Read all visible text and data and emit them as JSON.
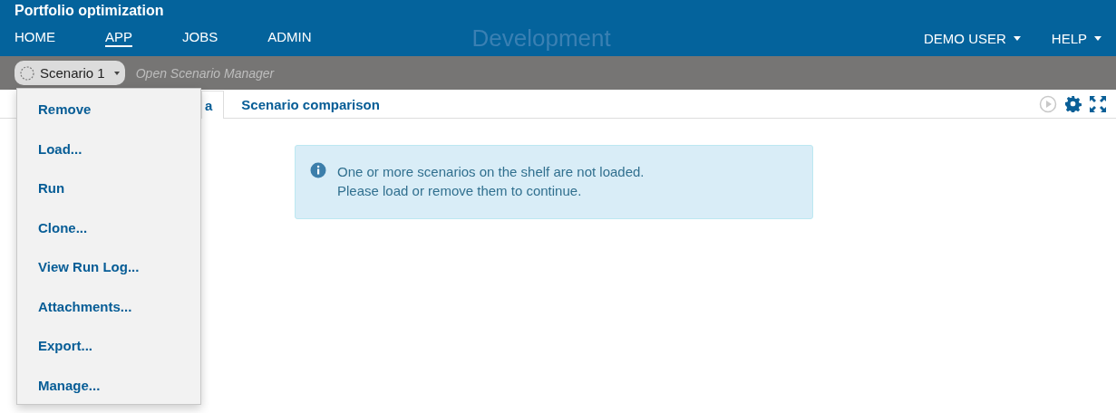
{
  "header": {
    "title": "Portfolio optimization",
    "nav": [
      {
        "label": "HOME",
        "selected": false
      },
      {
        "label": "APP",
        "selected": true
      },
      {
        "label": "JOBS",
        "selected": false
      },
      {
        "label": "ADMIN",
        "selected": false
      }
    ],
    "environment": "Development",
    "right_menus": [
      {
        "label": "DEMO USER"
      },
      {
        "label": "HELP"
      }
    ]
  },
  "scenario_bar": {
    "scenario": "Scenario 1",
    "manager_link": "Open Scenario Manager"
  },
  "tabs": [
    {
      "label": "a",
      "selected": true
    },
    {
      "label": "Scenario comparison",
      "selected": false
    }
  ],
  "toolbar": [
    {
      "kind": "run",
      "disabled": true
    },
    {
      "kind": "settings",
      "disabled": false
    },
    {
      "kind": "fullscreen",
      "disabled": false
    }
  ],
  "alert": {
    "lines": [
      "One or more scenarios on the shelf are not loaded.",
      "Please load or remove them to continue."
    ]
  },
  "menu": {
    "items": [
      "Remove",
      "Load...",
      "Run",
      "Clone...",
      "View Run Log...",
      "Attachments...",
      "Export...",
      "Manage..."
    ]
  }
}
